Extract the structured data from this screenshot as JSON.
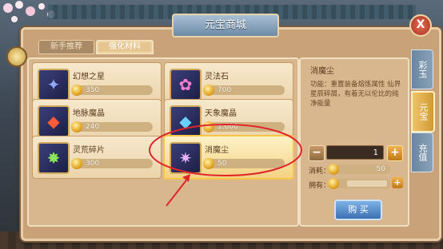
{
  "window": {
    "title": "元宝商城",
    "close_label": "X"
  },
  "tabs": [
    {
      "label": "新手推荐"
    },
    {
      "label": "强化材料"
    }
  ],
  "items": [
    {
      "name": "幻想之星",
      "price": "350",
      "icon": "star-gem-icon",
      "glyph": "✦",
      "glyph_color": "#8fa9ff"
    },
    {
      "name": "灵法石",
      "price": "700",
      "icon": "pink-stone-icon",
      "glyph": "✿",
      "glyph_color": "#ff7fd1"
    },
    {
      "name": "地脉魔晶",
      "price": "240",
      "icon": "red-crystal-icon",
      "glyph": "◆",
      "glyph_color": "#ff5a3a"
    },
    {
      "name": "天象魔晶",
      "price": "1,000",
      "icon": "blue-crystal-icon",
      "glyph": "◆",
      "glyph_color": "#6ad0ff"
    },
    {
      "name": "灵荒碎片",
      "price": "300",
      "icon": "green-fragment-icon",
      "glyph": "✸",
      "glyph_color": "#8be35a"
    },
    {
      "name": "消魔尘",
      "price": "50",
      "icon": "purple-dust-icon",
      "glyph": "✷",
      "glyph_color": "#e6b3ff"
    }
  ],
  "detail": {
    "title": "消魔尘",
    "description": "功能：重置装备熔炼属性 仙界星辰碎屑，有着无以伦比的纯净能量",
    "quantity": "1",
    "cost_label": "消耗：",
    "cost_value": "50",
    "own_label": "拥有：",
    "buy_label": "购 买"
  },
  "side_tabs": [
    {
      "label": "彩玉"
    },
    {
      "label": "元宝"
    },
    {
      "label": "充值"
    }
  ],
  "colors": {
    "accent": "#f7c54a",
    "annotation": "#e0252b"
  }
}
